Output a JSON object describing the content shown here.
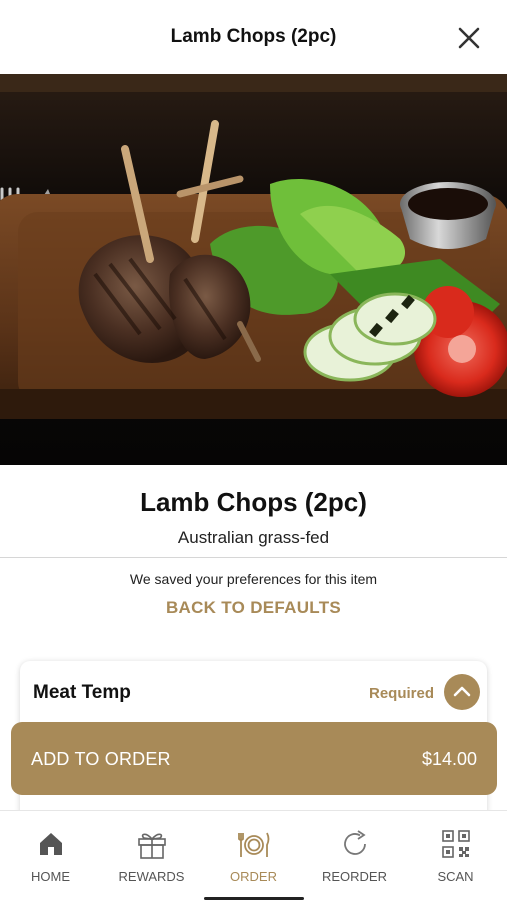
{
  "header": {
    "title": "Lamb Chops (2pc)"
  },
  "item": {
    "name": "Lamb Chops (2pc)",
    "description": "Australian grass-fed"
  },
  "preferences": {
    "note": "We saved your preferences for this item",
    "reset_label": "BACK TO DEFAULTS"
  },
  "modifier": {
    "title": "Meat Temp",
    "status": "Required",
    "expanded": true
  },
  "cart": {
    "add_label": "ADD TO ORDER",
    "price": "$14.00"
  },
  "tabs": [
    {
      "label": "HOME",
      "icon": "home-icon",
      "active": false
    },
    {
      "label": "REWARDS",
      "icon": "gift-icon",
      "active": false
    },
    {
      "label": "ORDER",
      "icon": "plate-cutlery-icon",
      "active": true
    },
    {
      "label": "REORDER",
      "icon": "reorder-icon",
      "active": false
    },
    {
      "label": "SCAN",
      "icon": "qr-code-icon",
      "active": false
    }
  ],
  "colors": {
    "accent": "#a88a58",
    "text": "#111111",
    "tab_inactive": "#555555"
  }
}
